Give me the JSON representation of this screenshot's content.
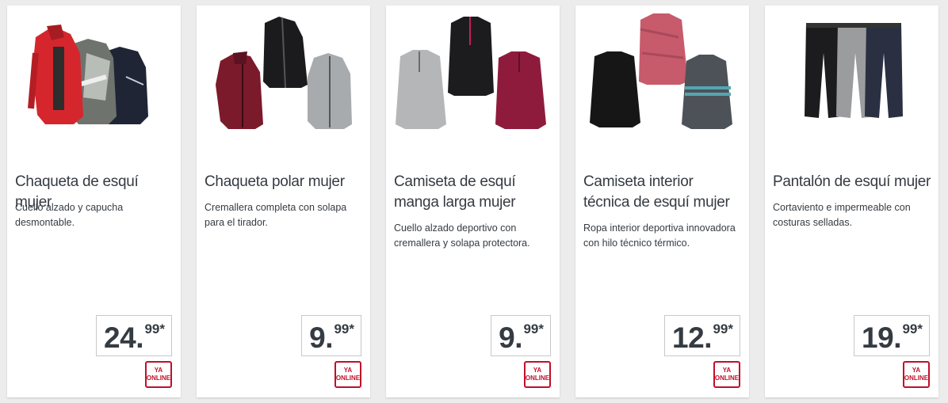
{
  "colors": {
    "accent": "#c0102a",
    "text": "#353b42",
    "card": "#ffffff",
    "bg": "#ececec"
  },
  "products": [
    {
      "title": "Chaqueta de esquí mujer",
      "description": "Cuello alzado y capucha desmontable.",
      "price_int": "24",
      "price_dec": "99*",
      "badge_line1": "YA",
      "badge_line2": "ONLINE",
      "image": "ski-jackets-image"
    },
    {
      "title": "Chaqueta polar mujer",
      "description": "Cremallera completa con solapa para el tirador.",
      "price_int": "9",
      "price_dec": "99*",
      "badge_line1": "YA",
      "badge_line2": "ONLINE",
      "image": "fleece-jackets-image"
    },
    {
      "title": "Camiseta de esquí manga larga mujer",
      "description": "Cuello alzado deportivo con cremallera y  solapa protectora.",
      "price_int": "9",
      "price_dec": "99*",
      "badge_line1": "YA",
      "badge_line2": "ONLINE",
      "image": "ski-shirts-image"
    },
    {
      "title": "Camiseta interior técnica de esquí mujer",
      "description": "Ropa interior deportiva innovadora con hilo técnico térmico.",
      "price_int": "12",
      "price_dec": "99*",
      "badge_line1": "YA",
      "badge_line2": "ONLINE",
      "image": "thermal-shirts-image"
    },
    {
      "title": "Pantalón de esquí mujer",
      "description": "Cortaviento e impermeable con costuras selladas.",
      "price_int": "19",
      "price_dec": "99*",
      "badge_line1": "YA",
      "badge_line2": "ONLINE",
      "image": "ski-pants-image"
    }
  ]
}
